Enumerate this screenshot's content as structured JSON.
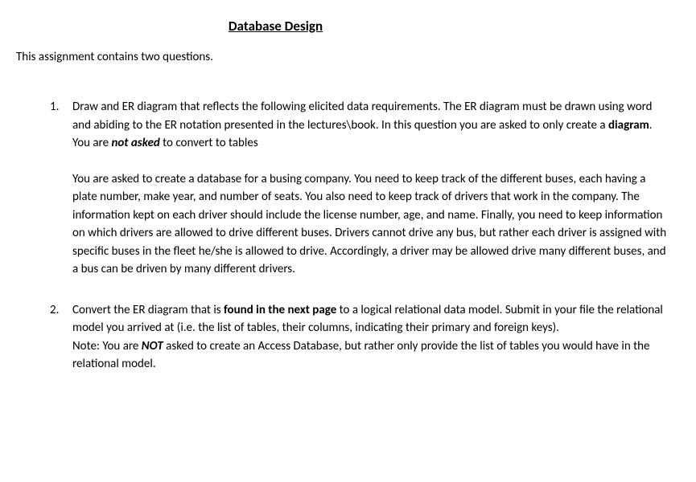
{
  "title": "Database Design",
  "intro": "This assignment contains two questions.",
  "items": [
    {
      "number": "1.",
      "p1_a": "Draw and ER diagram that reflects the following elicited data requirements. The ER diagram must be drawn using word and abiding to the ER notation presented in the lectures\\book. In this question you are asked to only create a ",
      "p1_b": "diagram",
      "p1_c": ". You are ",
      "p1_d": "not asked",
      "p1_e": " to convert to tables",
      "p2": "You are asked to create a database for a busing company. You need to keep track of the different buses, each having a plate number, make year, and number of seats. You also need to keep track of drivers that work in the company. The information kept on each driver should include the license number, age, and name. Finally, you need to keep information on which drivers are allowed to drive different buses. Drivers cannot drive any bus, but rather each driver is assigned with specific buses in the fleet he/she is allowed to drive. Accordingly, a driver may be allowed drive many different buses, and a bus can be driven by many different drivers."
    },
    {
      "number": "2.",
      "p1_a": "Convert the ER diagram that is ",
      "p1_b": "found in the next page",
      "p1_c": " to a logical relational data model. Submit in your file the relational model you arrived at (i.e. the list of tables, their columns, indicating their primary and foreign keys).",
      "note_a": "Note: You are ",
      "note_b": "NOT",
      "note_c": " asked to create an Access Database, but rather only provide the list of tables you would have in the relational model."
    }
  ]
}
